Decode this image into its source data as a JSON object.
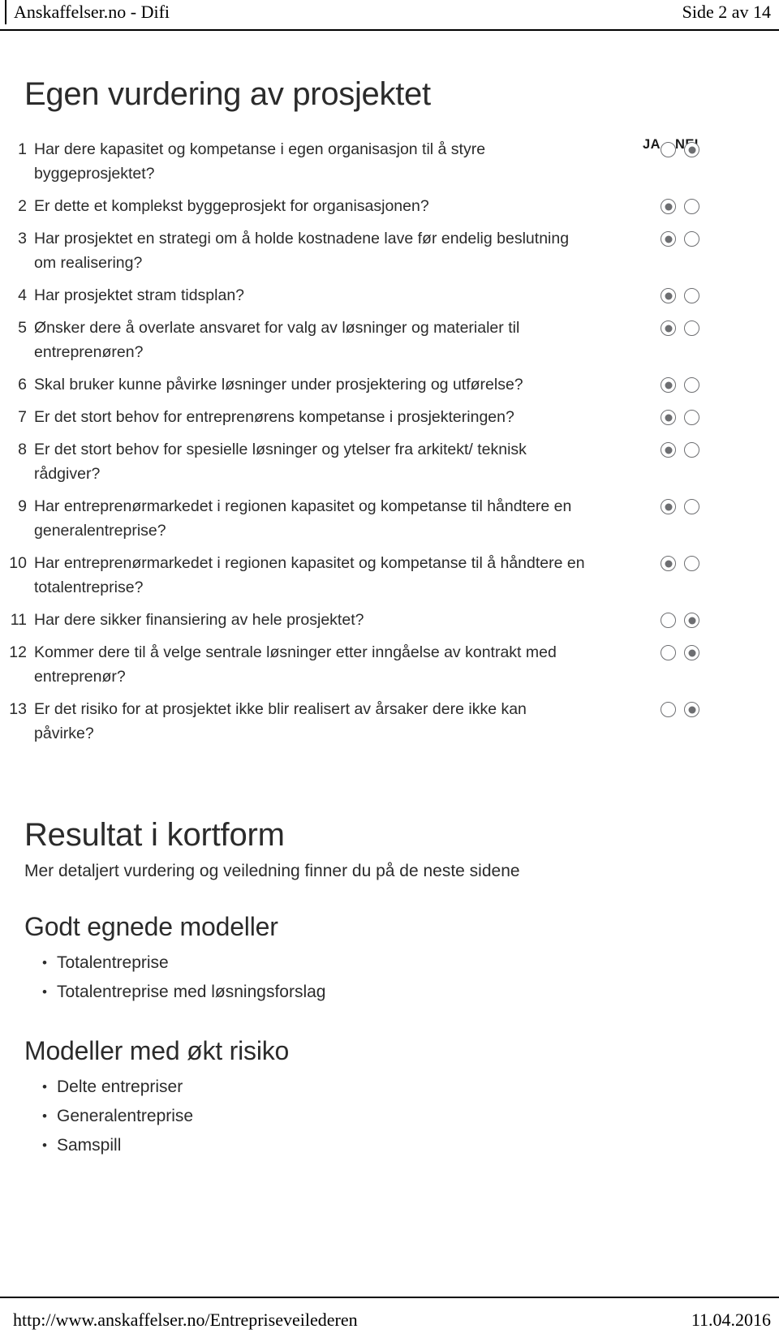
{
  "header": {
    "left_text": "Anskaffelser.no - Difi",
    "right_text": "Side 2 av 14"
  },
  "title": "Egen vurdering av prosjektet",
  "questionnaire": {
    "col_yes": "JA",
    "col_no": "NEI",
    "questions": [
      {
        "num": "1",
        "text": "Har dere kapasitet og kompetanse i egen organisasjon til å styre byggeprosjektet?",
        "answer": "NEI"
      },
      {
        "num": "2",
        "text": "Er dette et komplekst byggeprosjekt for organisasjonen?",
        "answer": "JA"
      },
      {
        "num": "3",
        "text": "Har prosjektet en strategi om å holde kostnadene lave før endelig beslutning om realisering?",
        "answer": "JA"
      },
      {
        "num": "4",
        "text": "Har prosjektet stram tidsplan?",
        "answer": "JA"
      },
      {
        "num": "5",
        "text": "Ønsker dere å overlate ansvaret for valg av løsninger og materialer til entreprenøren?",
        "answer": "JA"
      },
      {
        "num": "6",
        "text": "Skal bruker kunne påvirke løsninger under prosjektering og utførelse?",
        "answer": "JA"
      },
      {
        "num": "7",
        "text": "Er det stort behov for entreprenørens kompetanse i prosjekteringen?",
        "answer": "JA"
      },
      {
        "num": "8",
        "text": "Er det stort behov for spesielle løsninger og ytelser fra arkitekt/ teknisk rådgiver?",
        "answer": "JA"
      },
      {
        "num": "9",
        "text": "Har entreprenørmarkedet i regionen kapasitet og kompetanse til håndtere en generalentreprise?",
        "answer": "JA"
      },
      {
        "num": "10",
        "text": "Har entreprenørmarkedet i regionen kapasitet og kompetanse til å håndtere en totalentreprise?",
        "answer": "JA"
      },
      {
        "num": "11",
        "text": "Har dere sikker finansiering av hele prosjektet?",
        "answer": "NEI"
      },
      {
        "num": "12",
        "text": "Kommer dere til å velge sentrale løsninger etter inngåelse av kontrakt med entreprenør?",
        "answer": "NEI"
      },
      {
        "num": "13",
        "text": "Er det risiko for at prosjektet ikke blir realisert av årsaker dere ikke kan påvirke?",
        "answer": "NEI"
      }
    ]
  },
  "results": {
    "heading": "Resultat i kortform",
    "subtitle": "Mer detaljert vurdering og veiledning finner du på de neste sidene",
    "groups": [
      {
        "heading": "Godt egnede modeller",
        "items": [
          "Totalentreprise",
          "Totalentreprise med løsningsforslag"
        ]
      },
      {
        "heading": "Modeller med økt risiko",
        "items": [
          "Delte entrepriser",
          "Generalentreprise",
          "Samspill"
        ]
      }
    ]
  },
  "footer": {
    "left_text": "http://www.anskaffelser.no/Entrepriseveilederen",
    "right_text": "11.04.2016"
  }
}
